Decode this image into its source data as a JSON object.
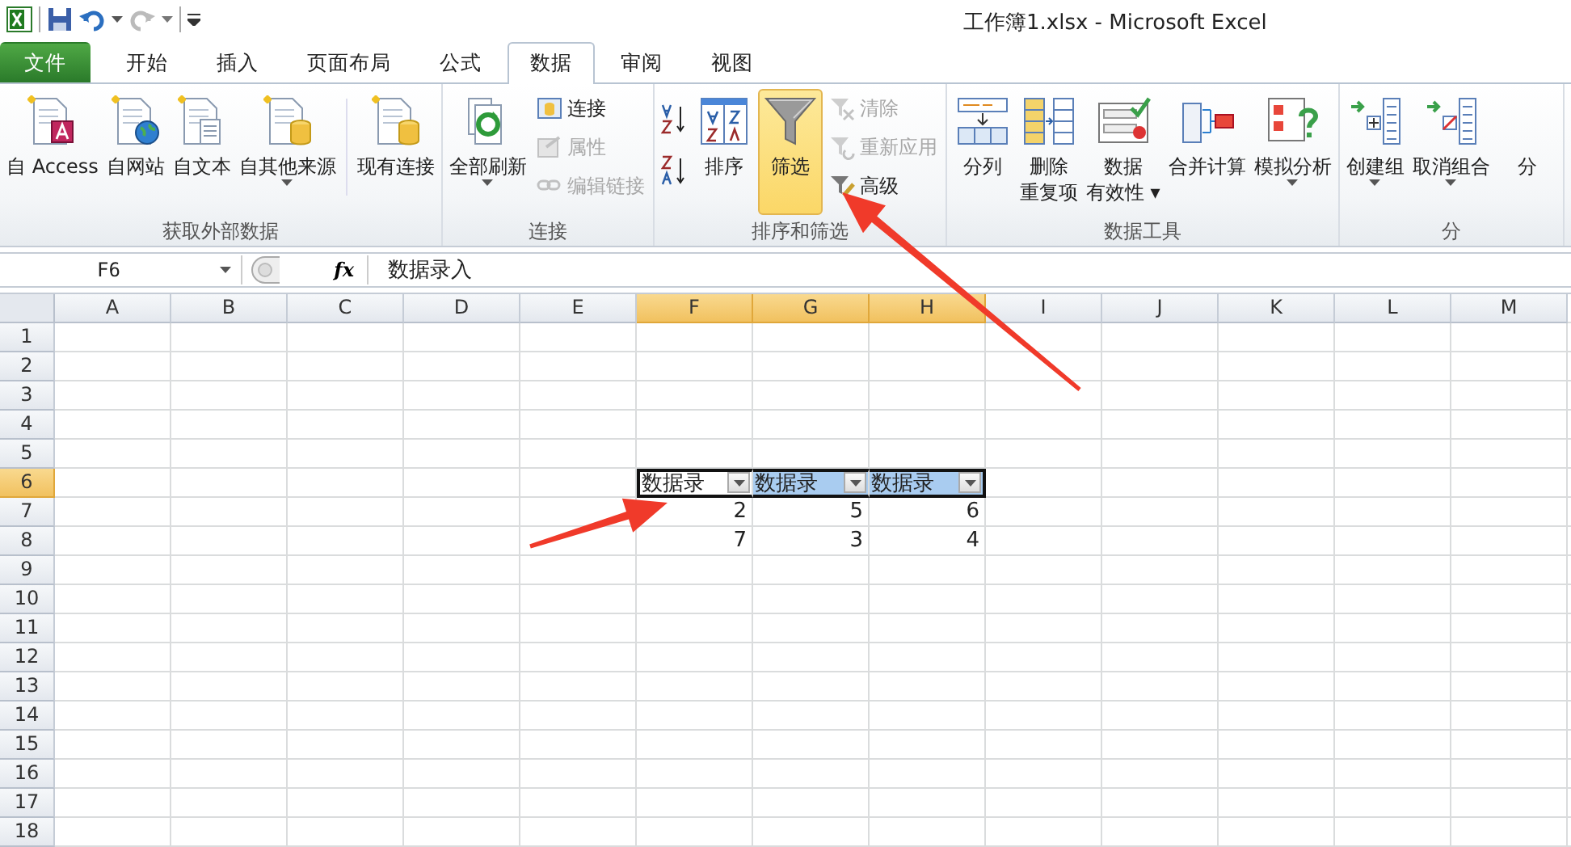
{
  "window": {
    "title": "工作簿1.xlsx  -  Microsoft Excel"
  },
  "tabs": [
    {
      "label": "文件",
      "kind": "file",
      "selected": false
    },
    {
      "label": "开始",
      "kind": "tab",
      "selected": false
    },
    {
      "label": "插入",
      "kind": "tab",
      "selected": false
    },
    {
      "label": "页面布局",
      "kind": "tab",
      "selected": false
    },
    {
      "label": "公式",
      "kind": "tab",
      "selected": false
    },
    {
      "label": "数据",
      "kind": "tab",
      "selected": true
    },
    {
      "label": "审阅",
      "kind": "tab",
      "selected": false
    },
    {
      "label": "视图",
      "kind": "tab",
      "selected": false
    }
  ],
  "ribbon_groups": [
    {
      "label": "获取外部数据",
      "items": [
        {
          "kind": "large",
          "lines": [
            "自 Access"
          ]
        },
        {
          "kind": "large",
          "lines": [
            "自网站"
          ]
        },
        {
          "kind": "large",
          "lines": [
            "自文本"
          ]
        },
        {
          "kind": "large",
          "lines": [
            "自其他来源"
          ],
          "dropdown": true
        },
        {
          "kind": "large",
          "lines": [
            "现有连接"
          ]
        }
      ]
    },
    {
      "label": "连接",
      "items": [
        {
          "kind": "large",
          "lines": [
            "全部刷新"
          ],
          "dropdown": true
        },
        {
          "kind": "stack",
          "buttons": [
            {
              "label": "连接",
              "disabled": false
            },
            {
              "label": "属性",
              "disabled": true
            },
            {
              "label": "编辑链接",
              "disabled": true
            }
          ]
        }
      ]
    },
    {
      "label": "排序和筛选",
      "items": [
        {
          "kind": "sort-pair"
        },
        {
          "kind": "large",
          "lines": [
            "排序"
          ]
        },
        {
          "kind": "large",
          "lines": [
            "筛选"
          ],
          "on": true
        },
        {
          "kind": "stack",
          "buttons": [
            {
              "label": "清除",
              "disabled": true
            },
            {
              "label": "重新应用",
              "disabled": true
            },
            {
              "label": "高级",
              "disabled": false
            }
          ]
        }
      ]
    },
    {
      "label": "数据工具",
      "items": [
        {
          "kind": "large",
          "lines": [
            "分列"
          ]
        },
        {
          "kind": "large",
          "lines": [
            "删除",
            "重复项"
          ]
        },
        {
          "kind": "large",
          "lines": [
            "数据",
            "有效性 ▾"
          ]
        },
        {
          "kind": "large",
          "lines": [
            "合并计算"
          ]
        },
        {
          "kind": "large",
          "lines": [
            "模拟分析"
          ],
          "dropdown": true
        }
      ]
    },
    {
      "label": "分",
      "items": [
        {
          "kind": "large",
          "lines": [
            "创建组"
          ],
          "dropdown": true
        },
        {
          "kind": "large",
          "lines": [
            "取消组合"
          ],
          "dropdown": true
        },
        {
          "kind": "large",
          "lines": [
            "分"
          ]
        }
      ]
    }
  ],
  "formula_bar": {
    "name_box": "F6",
    "function_label": "fx",
    "value": "数据录入"
  },
  "sheet": {
    "columns": [
      {
        "label": "A",
        "selected": false
      },
      {
        "label": "B",
        "selected": false
      },
      {
        "label": "C",
        "selected": false
      },
      {
        "label": "D",
        "selected": false
      },
      {
        "label": "E",
        "selected": false
      },
      {
        "label": "F",
        "selected": true
      },
      {
        "label": "G",
        "selected": true
      },
      {
        "label": "H",
        "selected": true
      },
      {
        "label": "I",
        "selected": false
      },
      {
        "label": "J",
        "selected": false
      },
      {
        "label": "K",
        "selected": false
      },
      {
        "label": "L",
        "selected": false
      },
      {
        "label": "M",
        "selected": false
      }
    ],
    "rows": [
      {
        "label": "1",
        "selected": false
      },
      {
        "label": "2",
        "selected": false
      },
      {
        "label": "3",
        "selected": false
      },
      {
        "label": "4",
        "selected": false
      },
      {
        "label": "5",
        "selected": false
      },
      {
        "label": "6",
        "selected": true
      },
      {
        "label": "7",
        "selected": false
      },
      {
        "label": "8",
        "selected": false
      },
      {
        "label": "9",
        "selected": false
      },
      {
        "label": "10",
        "selected": false
      },
      {
        "label": "11",
        "selected": false
      },
      {
        "label": "12",
        "selected": false
      },
      {
        "label": "13",
        "selected": false
      },
      {
        "label": "14",
        "selected": false
      },
      {
        "label": "15",
        "selected": false
      },
      {
        "label": "16",
        "selected": false
      },
      {
        "label": "17",
        "selected": false
      },
      {
        "label": "18",
        "selected": false
      }
    ],
    "table": {
      "header": [
        {
          "text": "数据录",
          "selected": false
        },
        {
          "text": "数据录",
          "selected": true
        },
        {
          "text": "数据录",
          "selected": true
        }
      ],
      "rows": [
        [
          "2",
          "5",
          "6"
        ],
        [
          "7",
          "3",
          "4"
        ]
      ]
    }
  }
}
